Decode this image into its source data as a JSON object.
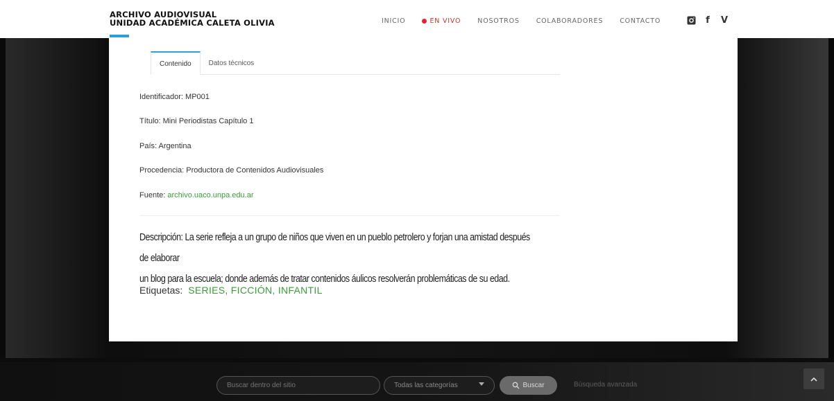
{
  "brand": {
    "line1": "ARCHIVO AUDIOVISUAL",
    "line2": "UNIDAD ACADÉMICA CALETA OLIVIA"
  },
  "nav": {
    "items": [
      "INICIO",
      "EN VIVO",
      "NOSOTROS",
      "COLABORADORES",
      "CONTACTO"
    ],
    "live_indicator_color": "#e3222e"
  },
  "social": {
    "icons": [
      "instagram-icon",
      "facebook-icon",
      "vimeo-icon"
    ],
    "facebook_glyph": "f",
    "vimeo_glyph": "V"
  },
  "tabs": [
    "Contenido",
    "Datos técnicos"
  ],
  "fields": {
    "identificador": "Identificador: MP001",
    "titulo": "Título: Mini Periodistas Capítulo 1",
    "pais": "País: Argentina",
    "procedencia": "Procedencia: Productora de Contenidos Audiovisuales",
    "fuente_label": "Fuente: ",
    "fuente_link": "archivo.uaco.unpa.edu.ar"
  },
  "description": {
    "line1": "Descripción: La serie refleja a un grupo de niños que viven en un pueblo petrolero y forjan una amistad después de elaborar",
    "line2": "un blog para la escuela; donde además de tratar contenidos áulicos resolverán problemáticas de su edad."
  },
  "tags": {
    "label": "Etiquetas:",
    "values": "SERIES, FICCIÓN, INFANTIL"
  },
  "footer": {
    "search_placeholder": "Buscar dentro del sitio",
    "category_selected": "Todas las categorías",
    "search_button": "Buscar",
    "advanced_search": "Búsqueda avanzada"
  },
  "colors": {
    "accent": "#2a9fd6",
    "link": "#3b9b3b"
  }
}
